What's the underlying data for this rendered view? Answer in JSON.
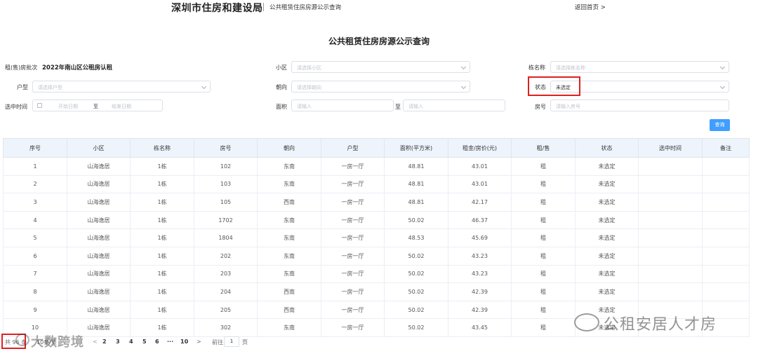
{
  "header": {
    "site_title": "深圳市住房和建设局",
    "subtitle": "公共租赁住房房源公示查询",
    "back_link": "返回首页 >"
  },
  "page_title": "公共租赁住房房源公示查询",
  "form": {
    "batch_label": "租(售)房批次",
    "batch_value": "2022年南山区公租房认租",
    "community_label": "小区",
    "community_placeholder": "请选择小区",
    "building_label": "栋名称",
    "building_placeholder": "请选择栋名称",
    "unit_type_label": "户型",
    "unit_type_placeholder": "请选择户型",
    "orientation_label": "朝向",
    "orientation_placeholder": "请选择朝向",
    "status_label": "状态",
    "status_value": "未选定",
    "selected_time_label": "选中时间",
    "start_date_placeholder": "开始日期",
    "to_label": "至",
    "end_date_placeholder": "结束日期",
    "area_label": "面积",
    "area_min_placeholder": "请输入",
    "area_to_label": "至",
    "area_max_placeholder": "请输入",
    "room_label": "房号",
    "room_placeholder": "请输入房号",
    "query_button": "查询"
  },
  "table": {
    "headers": [
      "序号",
      "小区",
      "栋名称",
      "房号",
      "朝向",
      "户型",
      "面积(平方米)",
      "租金/房价(元)",
      "租/售",
      "状态",
      "选中时间",
      "备注"
    ],
    "rows": [
      [
        "1",
        "山海逸居",
        "1栋",
        "102",
        "东南",
        "一房一厅",
        "48.81",
        "43.01",
        "租",
        "未选定",
        "",
        ""
      ],
      [
        "2",
        "山海逸居",
        "1栋",
        "103",
        "东南",
        "一房一厅",
        "48.81",
        "43.01",
        "租",
        "未选定",
        "",
        ""
      ],
      [
        "3",
        "山海逸居",
        "1栋",
        "105",
        "西南",
        "一房一厅",
        "48.81",
        "42.17",
        "租",
        "未选定",
        "",
        ""
      ],
      [
        "4",
        "山海逸居",
        "1栋",
        "1702",
        "东南",
        "一房一厅",
        "50.02",
        "46.37",
        "租",
        "未选定",
        "",
        ""
      ],
      [
        "5",
        "山海逸居",
        "1栋",
        "1804",
        "东南",
        "一房一厅",
        "48.53",
        "45.69",
        "租",
        "未选定",
        "",
        ""
      ],
      [
        "6",
        "山海逸居",
        "1栋",
        "202",
        "东南",
        "一房一厅",
        "50.02",
        "43.23",
        "租",
        "未选定",
        "",
        ""
      ],
      [
        "7",
        "山海逸居",
        "1栋",
        "203",
        "东南",
        "一房一厅",
        "50.02",
        "43.23",
        "租",
        "未选定",
        "",
        ""
      ],
      [
        "8",
        "山海逸居",
        "1栋",
        "204",
        "西南",
        "一房一厅",
        "50.02",
        "42.39",
        "租",
        "未选定",
        "",
        ""
      ],
      [
        "9",
        "山海逸居",
        "1栋",
        "205",
        "西南",
        "一房一厅",
        "50.02",
        "42.39",
        "租",
        "未选定",
        "",
        ""
      ],
      [
        "10",
        "山海逸居",
        "1栋",
        "302",
        "东南",
        "一房一厅",
        "50.02",
        "43.45",
        "租",
        "未选定",
        "",
        ""
      ]
    ]
  },
  "pagination": {
    "total": "共 96 条",
    "page_size": "10条/页",
    "prev": "<",
    "pages": [
      "2",
      "3",
      "4",
      "5",
      "6",
      "···",
      "10"
    ],
    "next": ">",
    "goto_label": "前往",
    "goto_value": "1",
    "page_unit": "页"
  },
  "watermarks": {
    "left": "大数跨境",
    "right": "公租安居人才房"
  },
  "colors": {
    "accent": "#409eff",
    "highlight_box": "#e02020",
    "header_bg": "#eef4fb"
  }
}
